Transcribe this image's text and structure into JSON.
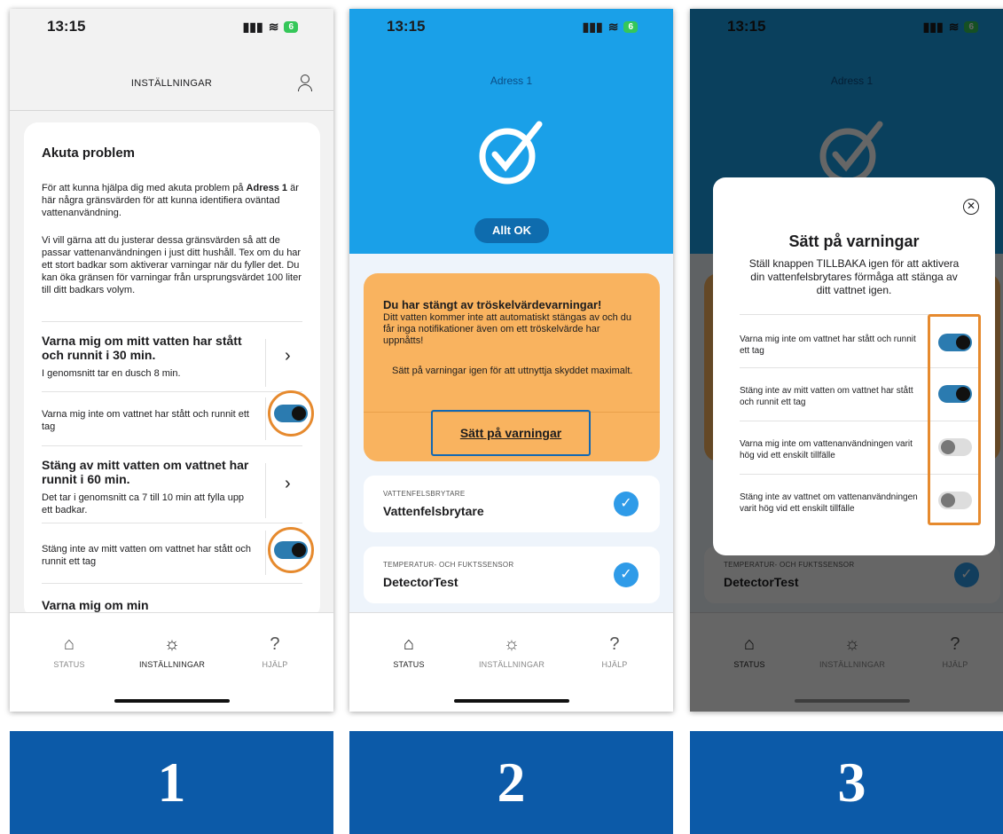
{
  "status_time": "13:15",
  "battery": "6",
  "p1": {
    "header": "INSTÄLLNINGAR",
    "title": "Akuta problem",
    "intro_pre": "För att kunna hjälpa dig med akuta problem på ",
    "intro_bold": "Adress 1",
    "intro_post": " är här några gränsvärden för att kunna identifiera oväntad vattenanvändning.",
    "intro2": "Vi vill gärna att du justerar dessa gränsvärden så att de passar vattenanvändningen i just ditt hushåll. Tex om du har ett stort badkar som aktiverar varningar när du fyller det. Du kan öka gränsen för varningar från ursprungsvärdet 100 liter till ditt badkars volym.",
    "s1_title": "Varna mig om mitt vatten har stått och runnit i 30 min.",
    "s1_sub": "I genomsnitt tar en dusch 8 min.",
    "s1_toggle": "Varna mig inte om vattnet har stått och runnit ett tag",
    "s2_title": "Stäng av mitt vatten om vattnet har runnit i 60 min.",
    "s2_sub": "Det tar i genomsnitt ca 7 till 10 min att fylla upp ett badkar.",
    "s2_toggle": "Stäng inte av mitt vatten om vattnet har stått och runnit ett tag",
    "s3_title": "Varna mig om min"
  },
  "nav": {
    "status": "STATUS",
    "settings": "INSTÄLLNINGAR",
    "help": "HJÄLP"
  },
  "p2": {
    "address": "Adress 1",
    "badge": "Allt OK",
    "warn_title": "Du har stängt av tröskelvärdevarningar!",
    "warn_body": "Ditt vatten kommer inte att automatiskt stängas av och du får inga notifikationer även om ett tröskelvärde har uppnåtts!",
    "warn_body2": "Sätt på varningar igen för att uttnyttja skyddet maximalt.",
    "warn_link": "Sätt på varningar",
    "sensor1_cap": "VATTENFELSBRYTARE",
    "sensor1_name": "Vattenfelsbrytare",
    "sensor2_cap": "TEMPERATUR- OCH FUKTSSENSOR",
    "sensor2_name": "DetectorTest"
  },
  "p3": {
    "modal_title": "Sätt på varningar",
    "modal_sub": "Ställ knappen TILLBAKA igen för att aktivera din vattenfelsbrytares förmåga att stänga av ditt vattnet igen.",
    "rows": [
      {
        "label": "Varna mig inte om vattnet har stått och runnit ett tag",
        "on": true
      },
      {
        "label": "Stäng inte av mitt vatten om vattnet har stått och runnit ett tag",
        "on": true
      },
      {
        "label": "Varna mig inte om vattenanvändningen varit hög vid ett enskilt tillfälle",
        "on": false
      },
      {
        "label": "Stäng inte av vattnet om vattenanvändningen varit hög vid ett enskilt tillfälle",
        "on": false
      }
    ]
  },
  "labels": [
    "1",
    "2",
    "3"
  ],
  "colors": {
    "blue": "#1aa0e8",
    "orange": "#f9b35f",
    "accent": "#e68a2e",
    "label_bg": "#0c5aa8"
  }
}
